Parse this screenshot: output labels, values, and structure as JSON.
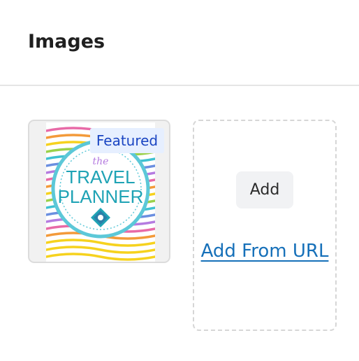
{
  "header": {
    "title": "Images"
  },
  "gallery": {
    "images": [
      {
        "badge": "Featured",
        "thumbnail": {
          "line1": "the",
          "line2": "TRAVEL",
          "line3": "PLANNER"
        }
      }
    ],
    "add_button_label": "Add",
    "add_from_url_label": "Add From URL"
  },
  "colors": {
    "badge_bg": "#e6efff",
    "badge_text": "#1a45c2",
    "link": "#1670b9",
    "teal": "#1fa3b5"
  }
}
